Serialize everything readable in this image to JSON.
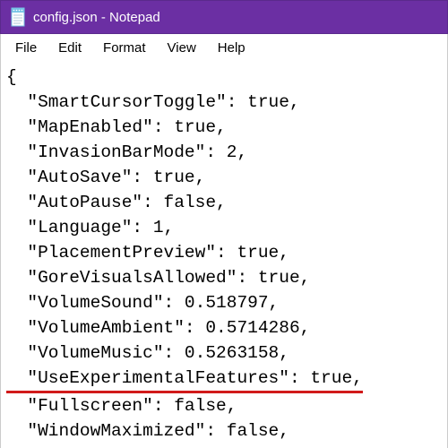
{
  "window": {
    "title": "config.json - Notepad"
  },
  "menubar": {
    "file": "File",
    "edit": "Edit",
    "format": "Format",
    "view": "View",
    "help": "Help"
  },
  "json_content": {
    "open_brace": "{",
    "indent": "  ",
    "entries": [
      {
        "key": "\"SmartCursorToggle\"",
        "value": "true",
        "highlighted": false
      },
      {
        "key": "\"MapEnabled\"",
        "value": "true",
        "highlighted": false
      },
      {
        "key": "\"InvasionBarMode\"",
        "value": "2",
        "highlighted": false
      },
      {
        "key": "\"AutoSave\"",
        "value": "true",
        "highlighted": false
      },
      {
        "key": "\"AutoPause\"",
        "value": "false",
        "highlighted": false
      },
      {
        "key": "\"Language\"",
        "value": "1",
        "highlighted": false
      },
      {
        "key": "\"PlacementPreview\"",
        "value": "true",
        "highlighted": false
      },
      {
        "key": "\"GoreVisualsAllowed\"",
        "value": "true",
        "highlighted": false
      },
      {
        "key": "\"VolumeSound\"",
        "value": "0.518797",
        "highlighted": false
      },
      {
        "key": "\"VolumeAmbient\"",
        "value": "0.5714286",
        "highlighted": false
      },
      {
        "key": "\"VolumeMusic\"",
        "value": "0.5263158",
        "highlighted": false
      },
      {
        "key": "\"UseExperimentalFeatures\"",
        "value": "true",
        "highlighted": true
      },
      {
        "key": "\"Fullscreen\"",
        "value": "false",
        "highlighted": false
      },
      {
        "key": "\"WindowMaximized\"",
        "value": "false",
        "highlighted": false
      }
    ]
  }
}
